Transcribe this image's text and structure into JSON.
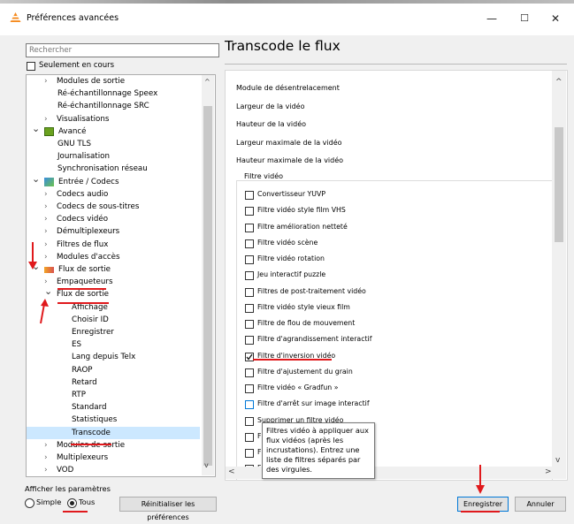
{
  "window": {
    "title": "Préférences avancées",
    "minimize": "—",
    "maximize": "☐",
    "close": "✕"
  },
  "search": {
    "placeholder": "Rechercher"
  },
  "only_current": "Seulement en cours",
  "tree": [
    {
      "label": "Modules de sortie",
      "indent": 2,
      "chevron": ">"
    },
    {
      "label": "Ré-échantillonnage Speex",
      "indent": 3
    },
    {
      "label": "Ré-échantillonnage SRC",
      "indent": 3
    },
    {
      "label": "Visualisations",
      "indent": 2,
      "chevron": ">"
    },
    {
      "label": "Avancé",
      "indent": 1,
      "chevron": "v",
      "icon": "advanced"
    },
    {
      "label": "GNU TLS",
      "indent": 3
    },
    {
      "label": "Journalisation",
      "indent": 3
    },
    {
      "label": "Synchronisation réseau",
      "indent": 3
    },
    {
      "label": "Entrée / Codecs",
      "indent": 1,
      "chevron": "v",
      "icon": "input"
    },
    {
      "label": "Codecs audio",
      "indent": 2,
      "chevron": ">"
    },
    {
      "label": "Codecs de sous-titres",
      "indent": 2,
      "chevron": ">"
    },
    {
      "label": "Codecs vidéo",
      "indent": 2,
      "chevron": ">"
    },
    {
      "label": "Démultiplexeurs",
      "indent": 2,
      "chevron": ">"
    },
    {
      "label": "Filtres de flux",
      "indent": 2,
      "chevron": ">"
    },
    {
      "label": "Modules d'accès",
      "indent": 2,
      "chevron": ">"
    },
    {
      "label": "Flux de sortie",
      "indent": 1,
      "chevron": "v",
      "icon": "stream"
    },
    {
      "label": "Empaqueteurs",
      "indent": 2,
      "chevron": ">"
    },
    {
      "label": "Flux de sortie",
      "indent": 2,
      "chevron": "v"
    },
    {
      "label": "Affichage",
      "indent": 4
    },
    {
      "label": "Choisir ID",
      "indent": 4
    },
    {
      "label": "Enregistrer",
      "indent": 4
    },
    {
      "label": "ES",
      "indent": 4
    },
    {
      "label": "Lang depuis Telx",
      "indent": 4
    },
    {
      "label": "RAOP",
      "indent": 4
    },
    {
      "label": "Retard",
      "indent": 4
    },
    {
      "label": "RTP",
      "indent": 4
    },
    {
      "label": "Standard",
      "indent": 4
    },
    {
      "label": "Statistiques",
      "indent": 4
    },
    {
      "label": "Transcode",
      "indent": 4,
      "selected": true
    },
    {
      "label": "Modules de sortie",
      "indent": 2,
      "chevron": ">"
    },
    {
      "label": "Multiplexeurs",
      "indent": 2,
      "chevron": ">"
    },
    {
      "label": "VOD",
      "indent": 2,
      "chevron": ">"
    }
  ],
  "heading": "Transcode le flux",
  "options": [
    "Module de désentrelacement",
    "Largeur de la vidéo",
    "Hauteur de la vidéo",
    "Largeur maximale de la vidéo",
    "Hauteur maximale de la vidéo"
  ],
  "filter_group_title": "Filtre vidéo",
  "filters": [
    {
      "label": "Convertisseur YUVP",
      "checked": false
    },
    {
      "label": "Filtre vidéo style film VHS",
      "checked": false
    },
    {
      "label": "Filtre amélioration netteté",
      "checked": false
    },
    {
      "label": "Filtre vidéo scène",
      "checked": false
    },
    {
      "label": "Filtre vidéo rotation",
      "checked": false
    },
    {
      "label": "Jeu interactif puzzle",
      "checked": false
    },
    {
      "label": "Filtres de post-traitement vidéo",
      "checked": false
    },
    {
      "label": "Filtre vidéo style vieux film",
      "checked": false
    },
    {
      "label": "Filtre de flou de mouvement",
      "checked": false
    },
    {
      "label": "Filtre d'agrandissement interactif",
      "checked": false
    },
    {
      "label": "Filtre d'inversion vidéo",
      "checked": true
    },
    {
      "label": "Filtre d'ajustement du grain",
      "checked": false
    },
    {
      "label": "Filtre vidéo « Gradfun »",
      "checked": false
    },
    {
      "label": "Filtre d'arrêt sur image interactif",
      "checked": false
    },
    {
      "label": "Supprimer un filtre vidéo",
      "checked": false
    },
    {
      "label": "F",
      "checked": false
    },
    {
      "label": "F",
      "checked": false
    },
    {
      "label": "F",
      "checked": false
    }
  ],
  "tooltip": "Filtres vidéo à appliquer aux flux vidéos (après les incrustations). Entrez une liste de filtres séparés par des virgules.",
  "show_params": {
    "label": "Afficher les paramètres",
    "simple": "Simple",
    "all": "Tous",
    "selected": "all"
  },
  "buttons": {
    "reset": "Réinitialiser les préférences",
    "save": "Enregistrer",
    "cancel": "Annuler"
  },
  "colors": {
    "selection": "#cce8ff",
    "annotation_red": "#e0191c"
  }
}
